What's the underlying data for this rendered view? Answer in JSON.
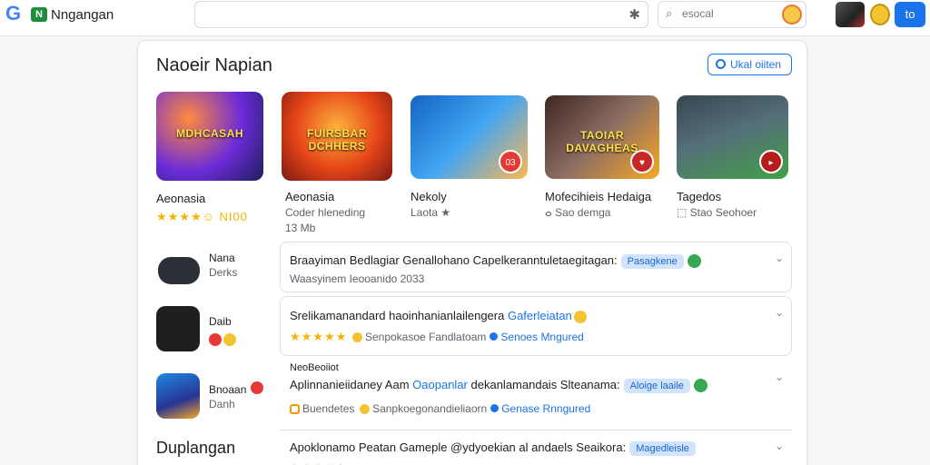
{
  "topbar": {
    "brand": "Nngangan",
    "search_placeholder": "",
    "search_small_placeholder": "esocal",
    "avatar_button": "to"
  },
  "card": {
    "title": "Naoeir Napian",
    "top_button": "Ukal oiiten"
  },
  "tiles": [
    {
      "art": "MDHCASAH",
      "label": "Aeonasia",
      "sub1": "★★★★☺ NI00",
      "sub2": ""
    },
    {
      "art": "FUIRSBAR DCHHERS",
      "label": "Aeonasia",
      "sub1": "Coder hleneding",
      "sub2": "13 Mb"
    },
    {
      "art": "",
      "badge": "03",
      "label": "Nekoly",
      "sub1": "Laota ★",
      "sub2": ""
    },
    {
      "art": "TAOIAR DAVAGHEAS",
      "label": "Mofecihieis Hedaiga",
      "sub1": "ⴰ Sao demga",
      "sub2": ""
    },
    {
      "art": "",
      "label": "Tagedos",
      "sub1": "⬚ Stao Seohoer",
      "sub2": ""
    }
  ],
  "apps": [
    {
      "name": "Nana",
      "sub": "Derks"
    },
    {
      "name": "Daib",
      "sub": ""
    },
    {
      "name": "Bnoaan",
      "sub": "Danh"
    }
  ],
  "section_heading": "Duplangan",
  "rows": [
    {
      "title": "Braayiman Bedlagiar Genallohano Capelkeranntuletaegitagan:",
      "pill": "Pasagkene",
      "sub": "Waasyinem Ieooanido 2033"
    },
    {
      "title": "Srelikamanandard haoinhanianlailengera",
      "link": "Gaferleiatan",
      "stars": "★★★★★",
      "sub": "Senpokasoe Fandlatoam",
      "sub_link": "Senoes Mngured"
    },
    {
      "kicker": "NeoBeoiiot",
      "title": "Aplinnanieiidaney Aam",
      "link": "Oaopanlar",
      "title_rest": "dekanlamandais Slteanama:",
      "pill": "Aloige laaile",
      "sub_prefix": "Buendetes",
      "sub": "Sanpkoegonandieliaorn",
      "sub_link": "Genase Rnngured"
    },
    {
      "title": "Apoklonamo Peatan Gameple @ydyoekian al andaels Seaikora:",
      "pill": "Magedleisle",
      "stars": "★★★★★"
    }
  ]
}
